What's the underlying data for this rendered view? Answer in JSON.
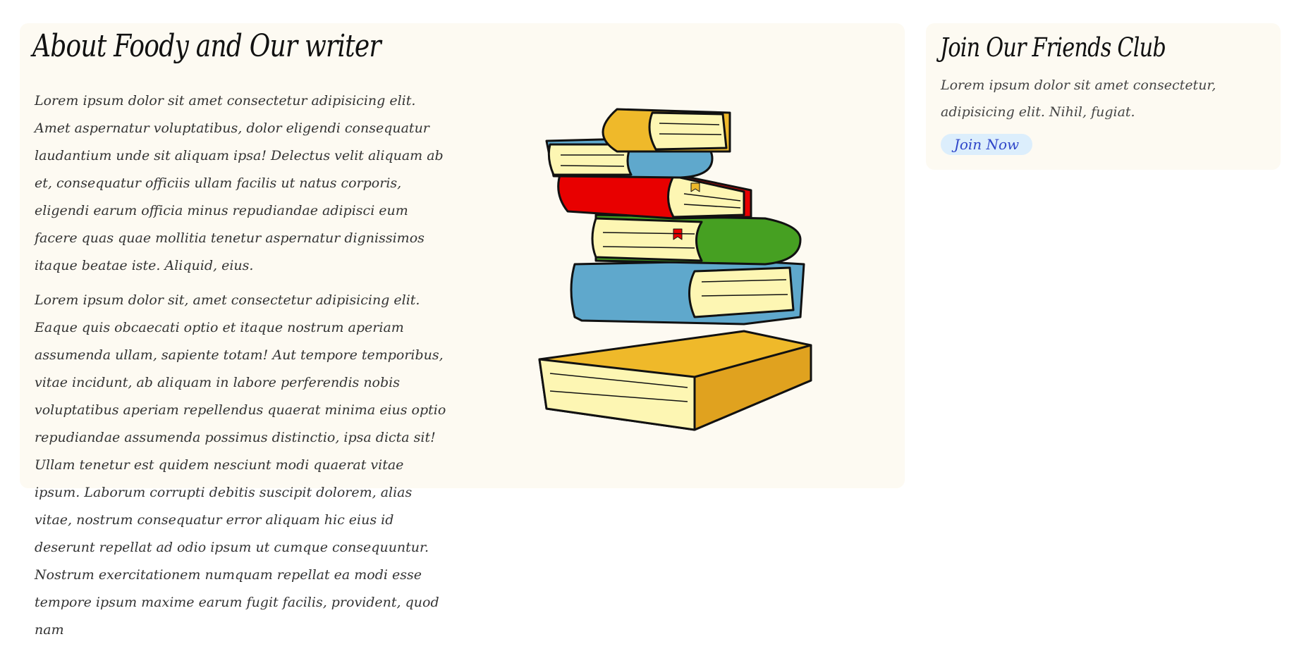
{
  "about": {
    "title": "About Foody and Our writer",
    "paragraph_1": "Lorem ipsum dolor sit amet consectetur adipisicing elit. Amet aspernatur voluptatibus, dolor eligendi consequatur laudantium unde sit aliquam ipsa! Delectus velit aliquam ab et, consequatur officiis ullam facilis ut natus corporis, eligendi earum officia minus repudiandae adipisci eum facere quas quae mollitia tenetur aspernatur dignissimos itaque beatae iste. Aliquid, eius.",
    "paragraph_2": "Lorem ipsum dolor sit, amet consectetur adipisicing elit. Eaque quis obcaecati optio et itaque nostrum aperiam assumenda ullam, sapiente totam! Aut tempore temporibus, vitae incidunt, ab aliquam in labore perferendis nobis voluptatibus aperiam repellendus quaerat minima eius optio repudiandae assumenda possimus distinctio, ipsa dicta sit! Ullam tenetur est quidem nesciunt modi quaerat vitae ipsum. Laborum corrupti debitis suscipit dolorem, alias vitae, nostrum consequatur error aliquam hic eius id deserunt repellat ad odio ipsum ut cumque consequuntur. Nostrum exercitationem numquam repellat ea modi esse tempore ipsum maxime earum fugit facilis, provident, quod nam",
    "image_icon": "stacked-books-illustration"
  },
  "club": {
    "title": "Join Our Friends Club",
    "text": "Lorem ipsum dolor sit amet consectetur, adipisicing elit. Nihil, fugiat.",
    "button_label": "Join Now"
  },
  "colors": {
    "card_background": "#fdfaf2",
    "button_background": "#dceefc",
    "button_text": "#2f46c9",
    "book_yellow": "#efb92a",
    "book_blue": "#5fa8cc",
    "book_red": "#e80000",
    "book_green": "#46a022",
    "page_cream": "#fdf6b3"
  }
}
